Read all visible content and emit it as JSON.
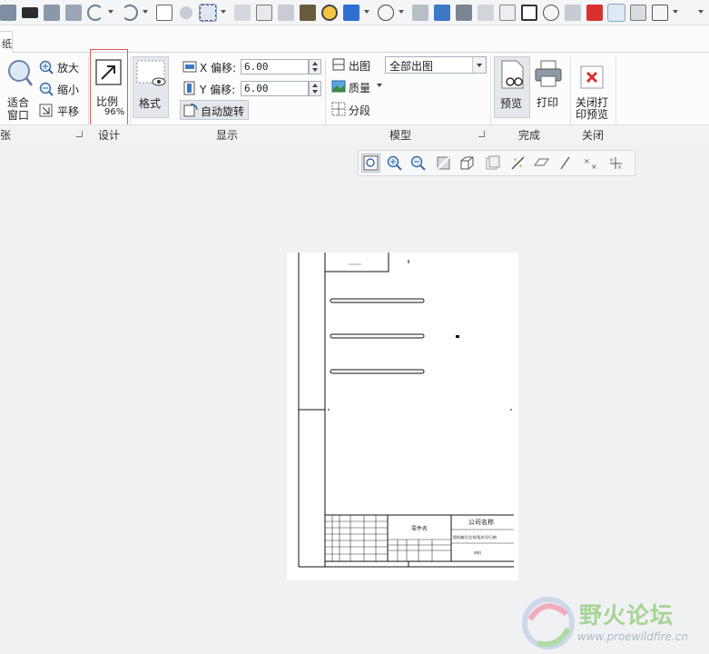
{
  "ribbon": {
    "tab_active_label": "纸",
    "sheet": {
      "fit_label": "适合窗口",
      "fit_line1": "适合",
      "fit_line2": "窗口",
      "zoom_in_label": "放大",
      "zoom_out_label": "缩小",
      "pan_label": "平移",
      "group_label": "纸张",
      "group_label_visible": "张"
    },
    "design": {
      "scale_label": "比例",
      "scale_value": "96%",
      "group_label": "设计"
    },
    "display": {
      "format_label": "格式",
      "x_label": "X 偏移:",
      "x_value": "6.00",
      "y_label": "Y 偏移:",
      "y_value": "6.00",
      "auto_rotate_label": "自动旋转",
      "group_label": "显示"
    },
    "model": {
      "output_label": "出图",
      "output_select_value": "全部出图",
      "quality_label": "质量",
      "segment_label": "分段",
      "group_label": "模型"
    },
    "finish": {
      "preview_label": "预览",
      "print_label": "打印",
      "group_label": "完成"
    },
    "close": {
      "close_preview_label": "关闭打印预览",
      "close_line1": "关闭打",
      "close_line2": "印预览",
      "group_label": "关闭"
    }
  },
  "drawing": {
    "title_block_name": "零件名",
    "company": "公司名称",
    "drawing_no": "图纸编号/比例/版本号/日期",
    "material": "材料"
  },
  "watermark": {
    "title": "野火论坛",
    "url": "www.proewildfire.cn"
  },
  "colors": {
    "accent": "#2b5fa8",
    "highlight": "#e05a5a",
    "close_red": "#d93030",
    "bg": "#f0f1f3"
  }
}
